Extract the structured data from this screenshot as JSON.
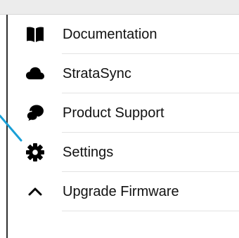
{
  "menu": {
    "items": [
      {
        "label": "Documentation",
        "icon": "book-open-icon"
      },
      {
        "label": "StrataSync",
        "icon": "cloud-icon"
      },
      {
        "label": "Product Support",
        "icon": "chat-bubbles-icon"
      },
      {
        "label": "Settings",
        "icon": "gear-icon"
      },
      {
        "label": "Upgrade Firmware",
        "icon": "chevron-up-icon"
      }
    ]
  },
  "colors": {
    "text": "#111111",
    "icon": "#000000",
    "divider": "#e3e3e3",
    "pointer": "#1a9fd6",
    "frame": "#303030"
  }
}
